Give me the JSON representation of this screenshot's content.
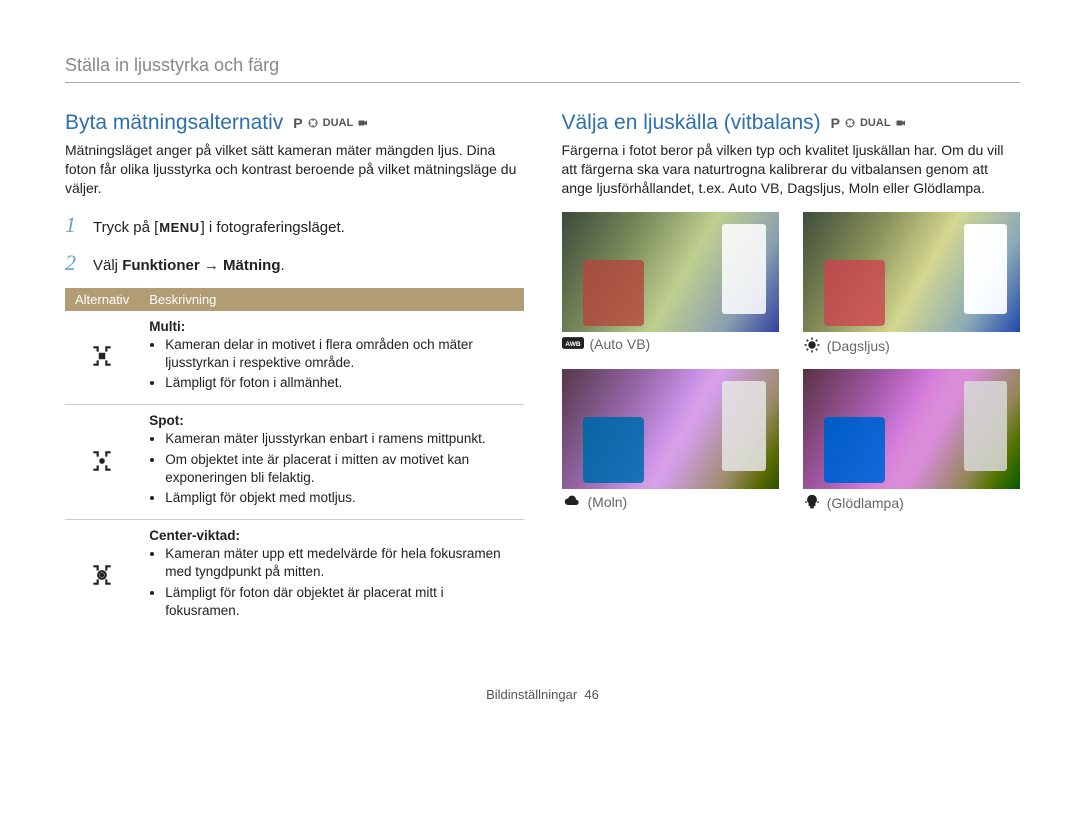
{
  "breadcrumb": "Ställa in ljusstyrka och färg",
  "modes": {
    "p": "P",
    "dual": "DUAL"
  },
  "left": {
    "title": "Byta mätningsalternativ",
    "intro": "Mätningsläget anger på vilket sätt kameran mäter mängden ljus. Dina foton får olika ljusstyrka och kontrast beroende på vilket mätningsläge du väljer.",
    "step1_a": "Tryck på [",
    "menu_label": "MENU",
    "step1_b": "] i fotograferingsläget.",
    "step2_a": "Välj ",
    "step2_bold": "Funktioner → Mätning",
    "step2_b": ".",
    "table": {
      "head_option": "Alternativ",
      "head_desc": "Beskrivning",
      "rows": [
        {
          "icon": "multi",
          "title": "Multi:",
          "bullets": [
            "Kameran delar in motivet i flera områden och mäter ljusstyrkan i respektive område.",
            "Lämpligt för foton i allmänhet."
          ]
        },
        {
          "icon": "spot",
          "title": "Spot:",
          "bullets": [
            "Kameran mäter ljusstyrkan enbart i ramens mittpunkt.",
            "Om objektet inte är placerat i mitten av motivet kan exponeringen bli felaktig.",
            "Lämpligt för objekt med motljus."
          ]
        },
        {
          "icon": "center",
          "title": "Center-viktad:",
          "bullets": [
            "Kameran mäter upp ett medelvärde för hela fokusramen med tyngdpunkt på mitten.",
            "Lämpligt för foton där objektet är placerat mitt i fokusramen."
          ]
        }
      ]
    }
  },
  "right": {
    "title": "Välja en ljuskälla (vitbalans)",
    "intro": "Färgerna i fotot beror på vilken typ och kvalitet ljuskällan har. Om du vill att färgerna ska vara naturtrogna kalibrerar du vitbalansen genom att ange ljusförhållandet, t.ex. Auto VB, Dagsljus, Moln eller Glödlampa.",
    "wb": [
      {
        "key": "auto",
        "label": "(Auto VB)",
        "icon": "awb"
      },
      {
        "key": "day",
        "label": "(Dagsljus)",
        "icon": "sun"
      },
      {
        "key": "cloud",
        "label": "(Moln)",
        "icon": "cloud"
      },
      {
        "key": "tung",
        "label": "(Glödlampa)",
        "icon": "bulb"
      }
    ]
  },
  "footer_label": "Bildinställningar",
  "footer_page": "46"
}
